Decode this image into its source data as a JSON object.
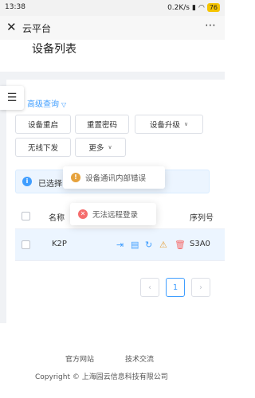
{
  "status_bar": {
    "time": "13:38",
    "network": "0.2K/s",
    "battery": "76"
  },
  "nav": {
    "title": "云平台",
    "close_icon": "close-icon",
    "more_icon": "more-dots-icon"
  },
  "page": {
    "title": "设备列表"
  },
  "search": {
    "advanced_label": "高级查询"
  },
  "toolbar": {
    "reboot": "设备重启",
    "reset_password": "重置密码",
    "upgrade": "设备升级",
    "wireless_push": "无线下发",
    "more": "更多"
  },
  "alert": {
    "text": "已选择"
  },
  "table": {
    "columns": [
      "名称",
      "序列号"
    ],
    "rows": [
      {
        "name": "K2P",
        "serial": "S3A0"
      }
    ]
  },
  "toasts": {
    "warning": "设备通讯内部错误",
    "error": "无法远程登录"
  },
  "pagination": {
    "current": "1",
    "prev": "‹",
    "next": "›"
  },
  "footer": {
    "link_official": "官方网站",
    "link_support": "技术交流",
    "copyright": "Copyright © 上海园云信息科技有限公司"
  },
  "colors": {
    "accent": "#409eff",
    "warning": "#e6a23c",
    "danger": "#f56c6c"
  }
}
